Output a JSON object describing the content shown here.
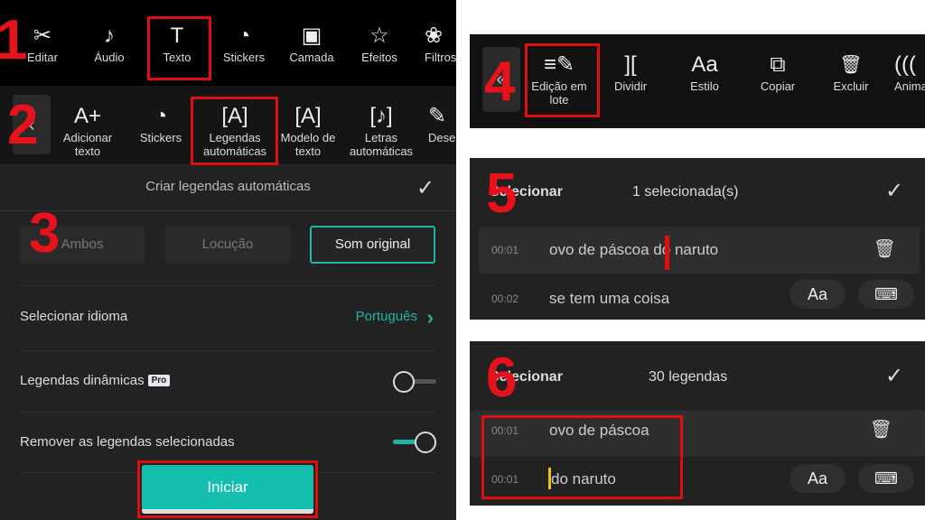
{
  "step_numbers": [
    "1",
    "2",
    "3",
    "4",
    "5",
    "6"
  ],
  "main_toolbar": {
    "items": [
      {
        "label": "Editar",
        "icon": "scissors-icon",
        "glyph": "✂"
      },
      {
        "label": "Áudio",
        "icon": "music-note-icon",
        "glyph": "♪"
      },
      {
        "label": "Texto",
        "icon": "text-icon",
        "glyph": "T"
      },
      {
        "label": "Stickers",
        "icon": "sticker-icon",
        "glyph": "◔"
      },
      {
        "label": "Camada",
        "icon": "layer-icon",
        "glyph": "▣"
      },
      {
        "label": "Efeitos",
        "icon": "star-icon",
        "glyph": "☆"
      },
      {
        "label": "Filtros",
        "icon": "filter-icon",
        "glyph": "❀"
      }
    ]
  },
  "text_toolbar": {
    "back_glyph": "‹",
    "items": [
      {
        "label": "Adicionar texto",
        "icon": "add-text-icon",
        "glyph": "A+"
      },
      {
        "label": "Stickers",
        "icon": "sticker-icon",
        "glyph": "◔"
      },
      {
        "label": "Legendas automáticas",
        "icon": "auto-captions-icon",
        "glyph": "[A]"
      },
      {
        "label": "Modelo de texto",
        "icon": "text-template-icon",
        "glyph": "[A]"
      },
      {
        "label": "Letras automáticas",
        "icon": "auto-lyrics-icon",
        "glyph": "[♪]"
      },
      {
        "label": "Desenhar",
        "icon": "draw-icon",
        "glyph": "✎"
      }
    ]
  },
  "captions_panel": {
    "title": "Criar legendas automáticas",
    "confirm_glyph": "✓",
    "sources": [
      "Ambos",
      "Locução",
      "Som original"
    ],
    "selected_source": "Som original",
    "language_label": "Selecionar idioma",
    "language_value": "Português",
    "chevron": "›",
    "dynamic_label": "Legendas dinâmicas",
    "pro_badge": "Pro",
    "dynamic_on": false,
    "remove_label": "Remover as legendas selecionadas",
    "remove_on": true,
    "start_label": "Iniciar"
  },
  "edit_toolbar": {
    "back_glyph": "«",
    "items": [
      {
        "label": "Edição em lote",
        "icon": "batch-edit-icon",
        "glyph": "≡✎"
      },
      {
        "label": "Dividir",
        "icon": "split-icon",
        "glyph": "]["
      },
      {
        "label": "Estilo",
        "icon": "style-icon",
        "glyph": "Aa"
      },
      {
        "label": "Copiar",
        "icon": "copy-icon",
        "glyph": "⧉"
      },
      {
        "label": "Excluir",
        "icon": "trash-icon",
        "glyph": "🗑"
      },
      {
        "label": "Animação",
        "icon": "animation-icon",
        "glyph": "((("
      }
    ]
  },
  "batch5": {
    "title": "Selecionar",
    "count": "1 selecionada(s)",
    "confirm_glyph": "✓",
    "rows": [
      {
        "time": "00:01",
        "text": "ovo de páscoa do naruto"
      },
      {
        "time": "00:02",
        "text": "se tem uma coisa"
      }
    ]
  },
  "batch6": {
    "title": "Selecionar",
    "count": "30 legendas",
    "confirm_glyph": "✓",
    "rows": [
      {
        "time": "00:01",
        "text": "ovo de páscoa"
      },
      {
        "time": "00:01",
        "text": "do naruto"
      }
    ]
  },
  "icons": {
    "trash": "🗑",
    "style": "Aa",
    "keyboard": "⌨"
  },
  "colors": {
    "accent": "#14bfaf",
    "highlight": "#e00f0f",
    "cursor": "#f2c21b"
  }
}
